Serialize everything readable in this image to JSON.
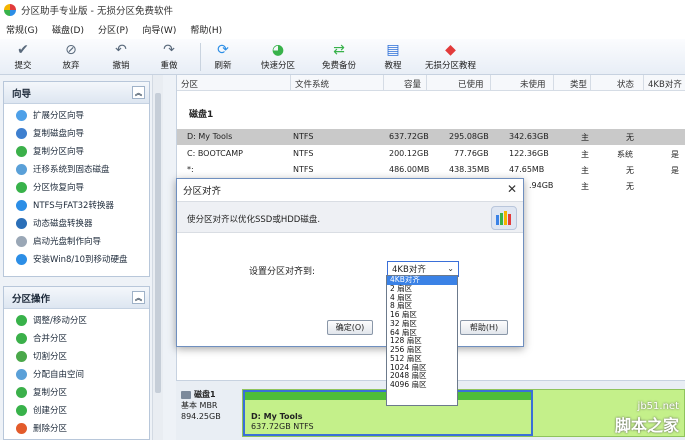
{
  "window": {
    "title": "分区助手专业版 - 无损分区免费软件"
  },
  "menu": [
    "常规(G)",
    "磁盘(D)",
    "分区(P)",
    "向导(W)",
    "帮助(H)"
  ],
  "toolbar": [
    {
      "label": "提交",
      "icon": "check-icon"
    },
    {
      "label": "放弃",
      "icon": "discard-icon"
    },
    {
      "label": "撤销",
      "icon": "undo-icon"
    },
    {
      "label": "重做",
      "icon": "redo-icon"
    },
    {
      "label": "刷新",
      "icon": "refresh-icon"
    },
    {
      "label": "快速分区",
      "icon": "quick-partition-icon"
    },
    {
      "label": "免费备份",
      "icon": "backup-icon"
    },
    {
      "label": "教程",
      "icon": "tutorial-icon"
    },
    {
      "label": "无损分区教程",
      "icon": "lossless-tutorial-icon"
    }
  ],
  "sidebar": {
    "wizard": {
      "title": "向导",
      "items": [
        "扩展分区向导",
        "复制磁盘向导",
        "复制分区向导",
        "迁移系统到固态磁盘",
        "分区恢复向导",
        "NTFS与FAT32转换器",
        "动态磁盘转换器",
        "启动光盘制作向导",
        "安装Win8/10到移动硬盘"
      ]
    },
    "ops": {
      "title": "分区操作",
      "items": [
        "调整/移动分区",
        "合并分区",
        "切割分区",
        "分配自由空间",
        "复制分区",
        "创建分区",
        "删除分区"
      ]
    }
  },
  "table": {
    "headers": [
      "分区",
      "文件系统",
      "容量",
      "已使用",
      "未使用",
      "类型",
      "状态",
      "4KB对齐"
    ],
    "group": "磁盘1",
    "rows": [
      [
        "D: My Tools",
        "NTFS",
        "637.72GB",
        "295.08GB",
        "342.63GB",
        "主",
        "无",
        ""
      ],
      [
        "C: BOOTCAMP",
        "NTFS",
        "200.12GB",
        "77.76GB",
        "122.36GB",
        "主",
        "系统",
        "是"
      ],
      [
        "*:",
        "NTFS",
        "486.00MB",
        "438.35MB",
        "47.65MB",
        "主",
        "无",
        "是"
      ],
      [
        "",
        "",
        "",
        "",
        ".94GB",
        "主",
        "无",
        ""
      ]
    ]
  },
  "diskmap": {
    "name": "磁盘1",
    "type": "基本 MBR",
    "size": "894.25GB",
    "partition_name": "D: My Tools",
    "partition_info": "637.72GB NTFS"
  },
  "dialog": {
    "title": "分区对齐",
    "description": "使分区对齐以优化SSD或HDD磁盘.",
    "label": "设置分区对齐到:",
    "selected": "4KB对齐",
    "ok": "确定(O)",
    "help": "帮助(H)",
    "options": [
      "4KB对齐",
      "2 扇区",
      "4 扇区",
      "8 扇区",
      "16 扇区",
      "32 扇区",
      "64 扇区",
      "128 扇区",
      "256 扇区",
      "512 扇区",
      "1024 扇区",
      "2048 扇区",
      "4096 扇区"
    ]
  },
  "watermark": {
    "url": "jb51.net",
    "name": "脚本之家"
  },
  "colors": {
    "accent": "#3b82e6",
    "partition_green": "#c4f08a",
    "selected_row": "#c9c9c9"
  }
}
